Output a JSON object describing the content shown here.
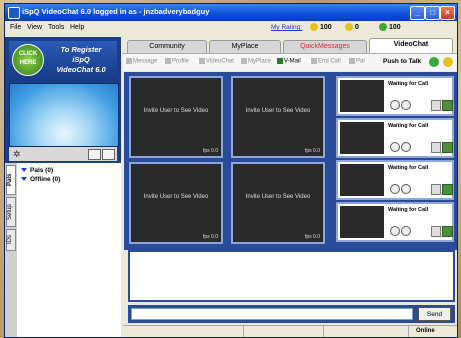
{
  "window": {
    "title": "iSpQ VideoChat 6.0 logged in as - jnzbadverybadguy",
    "min": "_",
    "max": "□",
    "close": "×"
  },
  "menu": {
    "file": "File",
    "view": "View",
    "tools": "Tools",
    "help": "Help",
    "rating_label": "My Rating:",
    "stat1": "100",
    "stat2": "0",
    "stat3": "100"
  },
  "logo": {
    "badge_line1": "CLICK",
    "badge_line2": "HERE",
    "text_line1": "To Register",
    "text_line2": "iSpQ",
    "text_line3": "VideoChat 6.0"
  },
  "sidebar": {
    "pals": "Pals (0)",
    "offline": "Offline (0)",
    "tabs": [
      "Pals",
      "Setup",
      "IDs"
    ]
  },
  "tabs": [
    "Community",
    "MyPlace",
    "QuickMessages",
    "VideoChat"
  ],
  "toolbar": {
    "message": "Message",
    "profile": "Profile",
    "videochat": "VideoChat",
    "myplace": "MyPlace",
    "vmail": "V-Mail",
    "endcall": "End Call",
    "pal": "Pal",
    "push_to_talk": "Push to Talk"
  },
  "video": {
    "invite": "Invite User to See Video",
    "fps": "fps 0.0",
    "waiting": "Waiting for Call"
  },
  "chat": {
    "send": "Send",
    "status": "Online"
  },
  "colors": {
    "title_blue": "#0a4fd6",
    "panel_blue": "#2a4c98",
    "quick_messages_red": "#e0263a",
    "coin_gold": "#e8c21a",
    "coin_green": "#3aa83a"
  }
}
